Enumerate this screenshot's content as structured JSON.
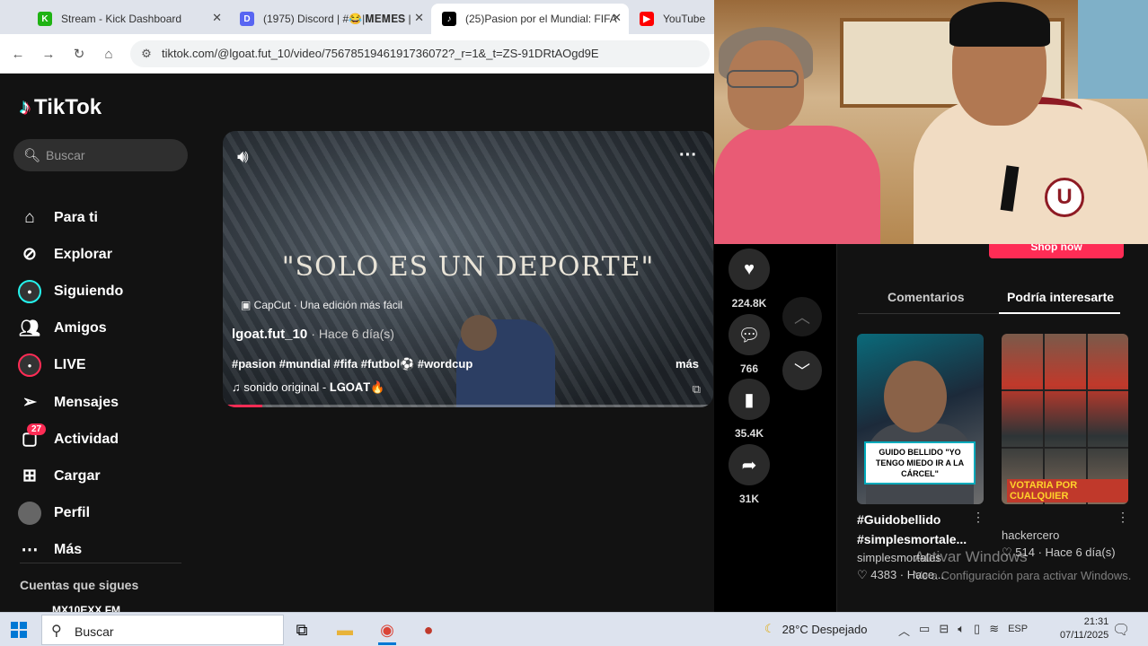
{
  "browser": {
    "tabs": [
      {
        "label": "Stream - Kick Dashboard",
        "favicon": "K",
        "color": "#1fb313"
      },
      {
        "label": "(1975) Discord | #😂|𝐌𝐄𝐌𝐄𝐒 |",
        "favicon": "D",
        "color": "#5865f2"
      },
      {
        "label": "(25)Pasion por el Mundial: FIFA",
        "favicon": "♪",
        "color": "#000000",
        "active": true
      },
      {
        "label": "YouTube",
        "favicon": "▶",
        "color": "#ff0000"
      }
    ],
    "url": "tiktok.com/@lgoat.fut_10/video/7567851946191736072?_r=1&_t=ZS-91DRtAOgd9E"
  },
  "tiktok": {
    "logo": "TikTok",
    "search_placeholder": "Buscar",
    "nav": [
      {
        "label": "Para ti",
        "icon": "home-icon"
      },
      {
        "label": "Explorar",
        "icon": "compass-icon"
      },
      {
        "label": "Siguiendo",
        "icon": "following-icon"
      },
      {
        "label": "Amigos",
        "icon": "friends-icon"
      },
      {
        "label": "LIVE",
        "icon": "live-icon"
      },
      {
        "label": "Mensajes",
        "icon": "message-icon"
      },
      {
        "label": "Actividad",
        "icon": "activity-icon",
        "badge": "27"
      },
      {
        "label": "Cargar",
        "icon": "upload-icon"
      },
      {
        "label": "Perfil",
        "icon": "profile-icon"
      },
      {
        "label": "Más",
        "icon": "more-icon"
      }
    ],
    "following_title": "Cuentas que sigues",
    "following_user": "MX10EXX FM"
  },
  "video": {
    "headline": "\"SOLO ES UN DEPORTE\"",
    "capcut": "CapCut · Una edición más fácil",
    "author": "lgoat.fut_10",
    "time": "· Hace 6 día(s)",
    "tags": "#pasion #mundial #fifa #futbol⚽ #wordcup",
    "more": "más",
    "sound": "sonido original - 𝐋𝐆𝐎𝐀𝐓🔥",
    "progress": 0.08
  },
  "actions": {
    "likes": "224.8K",
    "comments": "766",
    "saves": "35.4K",
    "shares": "31K"
  },
  "right_panel": {
    "shop_label": "Shop now",
    "tab_comments": "Comentarios",
    "tab_suggest": "Podría interesarte",
    "card1": {
      "caption": "GUIDO BELLIDO \"YO TENGO MIEDO IR A LA CÁRCEL\"",
      "title_line1": "#Guidobellido",
      "title_line2": "#simplesmortale...",
      "user": "simplesmortales",
      "meta": "♡ 4383 · Hace..."
    },
    "card2": {
      "overlay": "VOTARIA POR CUALQUIER",
      "user": "hackercero",
      "meta": "♡ 514 · Hace 6 día(s)"
    },
    "watermark1": "Activar Windows",
    "watermark2": "Ve a Configuración para activar Windows."
  },
  "taskbar": {
    "search": "Buscar",
    "weather": "28°C  Despejado",
    "lang": "ESP",
    "time": "21:31",
    "date": "07/11/2025"
  }
}
